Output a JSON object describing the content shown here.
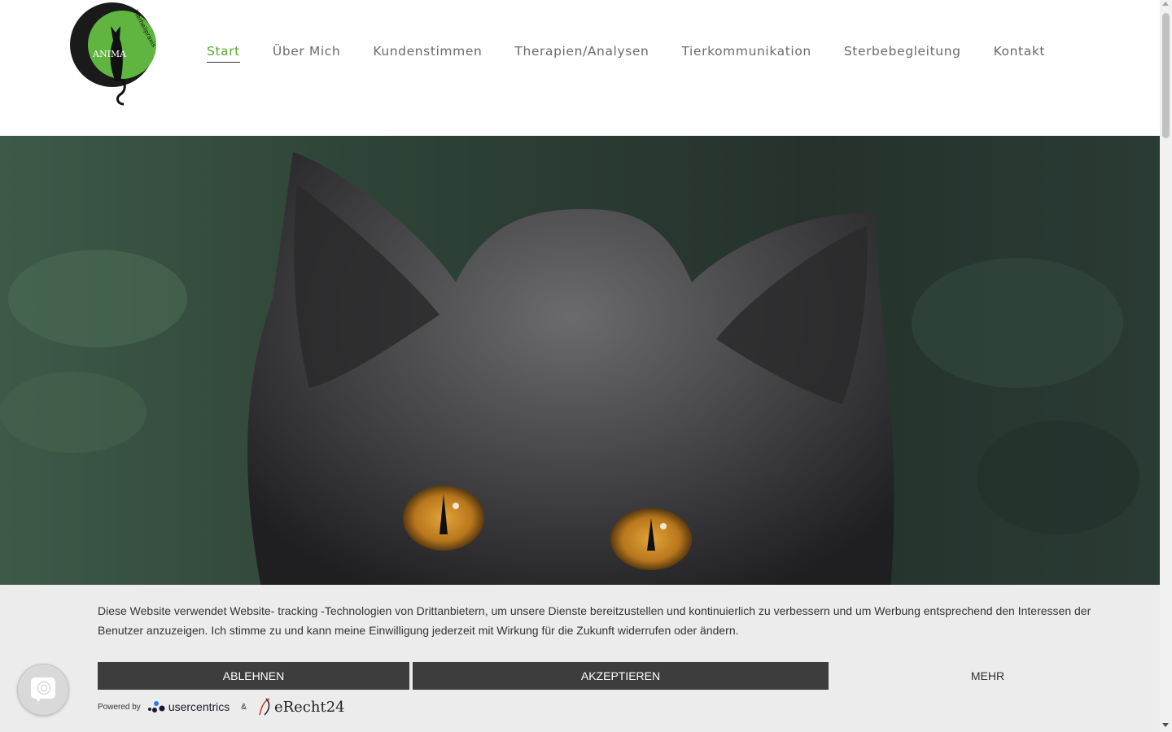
{
  "logo": {
    "brand_text": "ANIMA",
    "arc_text": "Tierheilpraxis"
  },
  "nav": {
    "items": [
      {
        "label": "Start",
        "active": true
      },
      {
        "label": "Über Mich",
        "active": false
      },
      {
        "label": "Kundenstimmen",
        "active": false
      },
      {
        "label": "Therapien/Analysen",
        "active": false
      },
      {
        "label": "Tierkommunikation",
        "active": false
      },
      {
        "label": "Sterbebegleitung",
        "active": false
      },
      {
        "label": "Kontakt",
        "active": false
      }
    ]
  },
  "hero": {
    "image": "grey-cat-with-amber-eyes"
  },
  "cookie": {
    "text": "Diese Website verwendet Website- tracking -Technologien von Drittanbietern, um unsere Dienste bereitzustellen und kontinuierlich zu verbessern und um Werbung entsprechend den Interessen der Benutzer anzuzeigen. Ich stimme zu und kann meine Einwilligung jederzeit mit Wirkung für die Zukunft widerrufen oder ändern.",
    "deny_label": "ABLEHNEN",
    "accept_label": "AKZEPTIEREN",
    "more_label": "MEHR",
    "powered_by": "Powered by",
    "uc_name": "usercentrics",
    "amp": "&",
    "er_name": "eRecht24"
  },
  "colors": {
    "accent": "#5aa832",
    "dark_button": "#3d3d3d",
    "banner_bg": "#ececec"
  },
  "icons": {
    "privacy": "fingerprint-chat-icon"
  }
}
